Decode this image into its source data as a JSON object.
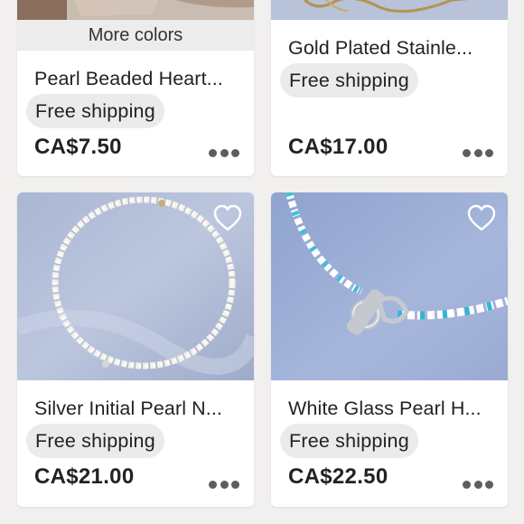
{
  "listings": [
    {
      "title": "Pearl Beaded Heart...",
      "shipping": "Free shipping",
      "price": "CA$7.50",
      "badge": "More colors",
      "icon": "more-options-icon"
    },
    {
      "title": "Gold Plated Stainle...",
      "shipping": "Free shipping",
      "price": "CA$17.00",
      "icon": "more-options-icon"
    },
    {
      "title": "Silver Initial Pearl N...",
      "shipping": "Free shipping",
      "price": "CA$21.00",
      "favorite_icon": "heart-outline-icon",
      "icon": "more-options-icon"
    },
    {
      "title": "White Glass Pearl H...",
      "shipping": "Free shipping",
      "price": "CA$22.50",
      "favorite_icon": "heart-outline-icon",
      "icon": "more-options-icon"
    }
  ],
  "colors": {
    "background": "#f1f0ef",
    "card": "#ffffff",
    "pill": "#ebebeb",
    "text": "#222222"
  }
}
